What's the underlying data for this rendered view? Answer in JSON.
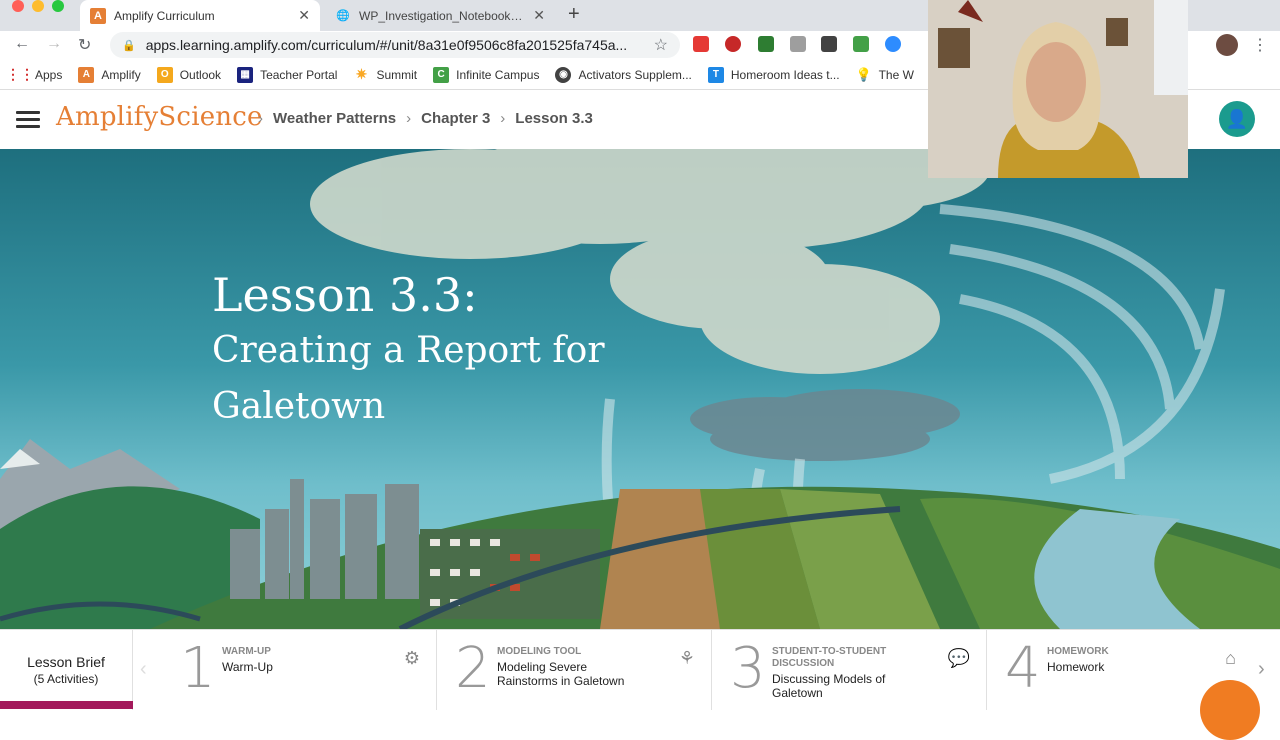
{
  "browser": {
    "tabs": [
      {
        "title": "Amplify Curriculum",
        "favicon_letter": "A",
        "active": true
      },
      {
        "title": "WP_Investigation_Notebook_Pag",
        "active": false
      }
    ],
    "url": "apps.learning.amplify.com/curriculum/#/unit/8a31e0f9506c8fa201525fa745a...",
    "bookmarks": [
      {
        "label": "Apps",
        "icon": "apps-grid-icon"
      },
      {
        "label": "Amplify",
        "icon": "amplify-icon"
      },
      {
        "label": "Outlook",
        "icon": "outlook-icon"
      },
      {
        "label": "Teacher Portal",
        "icon": "portal-icon"
      },
      {
        "label": "Summit",
        "icon": "sun-icon"
      },
      {
        "label": "Infinite Campus",
        "icon": "campus-icon"
      },
      {
        "label": "Activators Supplem...",
        "icon": "globe-icon"
      },
      {
        "label": "Homeroom Ideas t...",
        "icon": "t-icon"
      },
      {
        "label": "The W",
        "icon": "bulb-icon"
      }
    ]
  },
  "header": {
    "logo_part1": "Amplify",
    "logo_part2": "Science",
    "breadcrumb": [
      "Weather Patterns",
      "Chapter 3",
      "Lesson 3.3"
    ]
  },
  "hero": {
    "lesson_number": "Lesson 3.3:",
    "lesson_title": "Creating a Report for Galetown"
  },
  "lesson_bar": {
    "brief_label": "Lesson Brief",
    "brief_count": "(5 Activities)",
    "activities": [
      {
        "number": "1",
        "category": "WARM-UP",
        "name": "Warm-Up",
        "icon": "head-gear-icon"
      },
      {
        "number": "2",
        "category": "MODELING TOOL",
        "name": "Modeling Severe Rainstorms in Galetown",
        "icon": "network-icon"
      },
      {
        "number": "3",
        "category": "STUDENT-TO-STUDENT DISCUSSION",
        "name": "Discussing Models of Galetown",
        "icon": "chat-bubbles-icon"
      },
      {
        "number": "4",
        "category": "HOMEWORK",
        "name": "Homework",
        "icon": "house-icon"
      }
    ]
  },
  "colors": {
    "brand_orange": "#e57f35",
    "teal_user": "#1b9b8e",
    "brief_accent": "#a3195b"
  }
}
